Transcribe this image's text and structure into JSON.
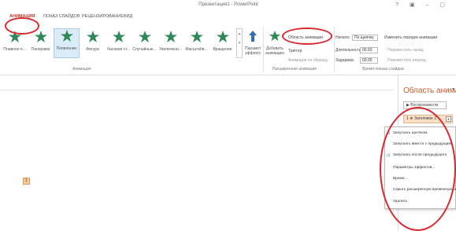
{
  "window": {
    "title": "Презентация1 - PowerPoint",
    "controls": "? ▣ – ▢"
  },
  "tabs": [
    {
      "label": "АНИМАЦИЯ",
      "active": true
    },
    {
      "label": "ПОКАЗ СЛАЙДОВ",
      "active": false
    },
    {
      "label": "РЕЦЕНЗИРОВАНИЕ",
      "active": false
    },
    {
      "label": "ВИД",
      "active": false
    }
  ],
  "ribbon": {
    "effects": [
      {
        "label": "Плавное п...",
        "icon": "star-icon",
        "color": "#2e8b57",
        "selected": false
      },
      {
        "label": "Панорама",
        "icon": "star-icon",
        "color": "#2e8b57",
        "selected": false
      },
      {
        "label": "Появление",
        "icon": "star-icon",
        "color": "#2e8b57",
        "selected": true
      },
      {
        "label": "Фигура",
        "icon": "star-icon",
        "color": "#2e8b57",
        "selected": false
      },
      {
        "label": "Часовая ст...",
        "icon": "star-icon",
        "color": "#2e8b57",
        "selected": false
      },
      {
        "label": "Случайные...",
        "icon": "star-icon",
        "color": "#2e8b57",
        "selected": false
      },
      {
        "label": "Увеличени...",
        "icon": "star-icon",
        "color": "#2e8b57",
        "selected": false
      },
      {
        "label": "Масштабв...",
        "icon": "star-icon",
        "color": "#2e8b57",
        "selected": false
      },
      {
        "label": "Вращение",
        "icon": "star-icon",
        "color": "#2e8b57",
        "selected": false
      }
    ],
    "effect_params_label": "Параметры",
    "effect_params_label2": "эффектов",
    "animation_group_label": "Анимация",
    "add_animation_label": "Добавить",
    "add_animation_label2": "анимацию",
    "animation_pane_label": "Область анимации",
    "trigger_label": "Триггер",
    "painter_label": "Анимация по образцу",
    "advanced_group_label": "Расширенная анимация",
    "start_label": "Начало:",
    "start_value": "По щелчку",
    "duration_label": "Длительность:",
    "duration_value": "00,50",
    "delay_label": "Задержка:",
    "delay_value": "00,00",
    "reorder_label": "Изменить порядок анимации",
    "move_earlier_label": "Переместить назад",
    "move_later_label": "Переместить вперед",
    "timing_group_label": "Время показа слайдов"
  },
  "slide": {
    "marker": "1"
  },
  "pane": {
    "title": "Область анима...",
    "close": "▾",
    "play_label": "▶ Воспроизвести",
    "item_label": "1 ★ Заголовок 1: ..."
  },
  "context_menu": [
    {
      "label": "Запускать щелчком",
      "icon": "mouse-icon"
    },
    {
      "label": "Запускать вместе с предыдущим",
      "icon": ""
    },
    {
      "label": "Запускать после предыдущего",
      "icon": "clock-icon"
    },
    {
      "label": "Параметры эффектов...",
      "icon": ""
    },
    {
      "label": "Время...",
      "icon": ""
    },
    {
      "label": "Скрыть расширенную временную шкалу",
      "icon": ""
    },
    {
      "label": "Удалить",
      "icon": ""
    }
  ],
  "colors": {
    "highlight": "#d9272e",
    "pane_title": "#cc5a2a",
    "selected_effect_bg": "#d9ecf8",
    "effect_star": "#2e8b57"
  }
}
